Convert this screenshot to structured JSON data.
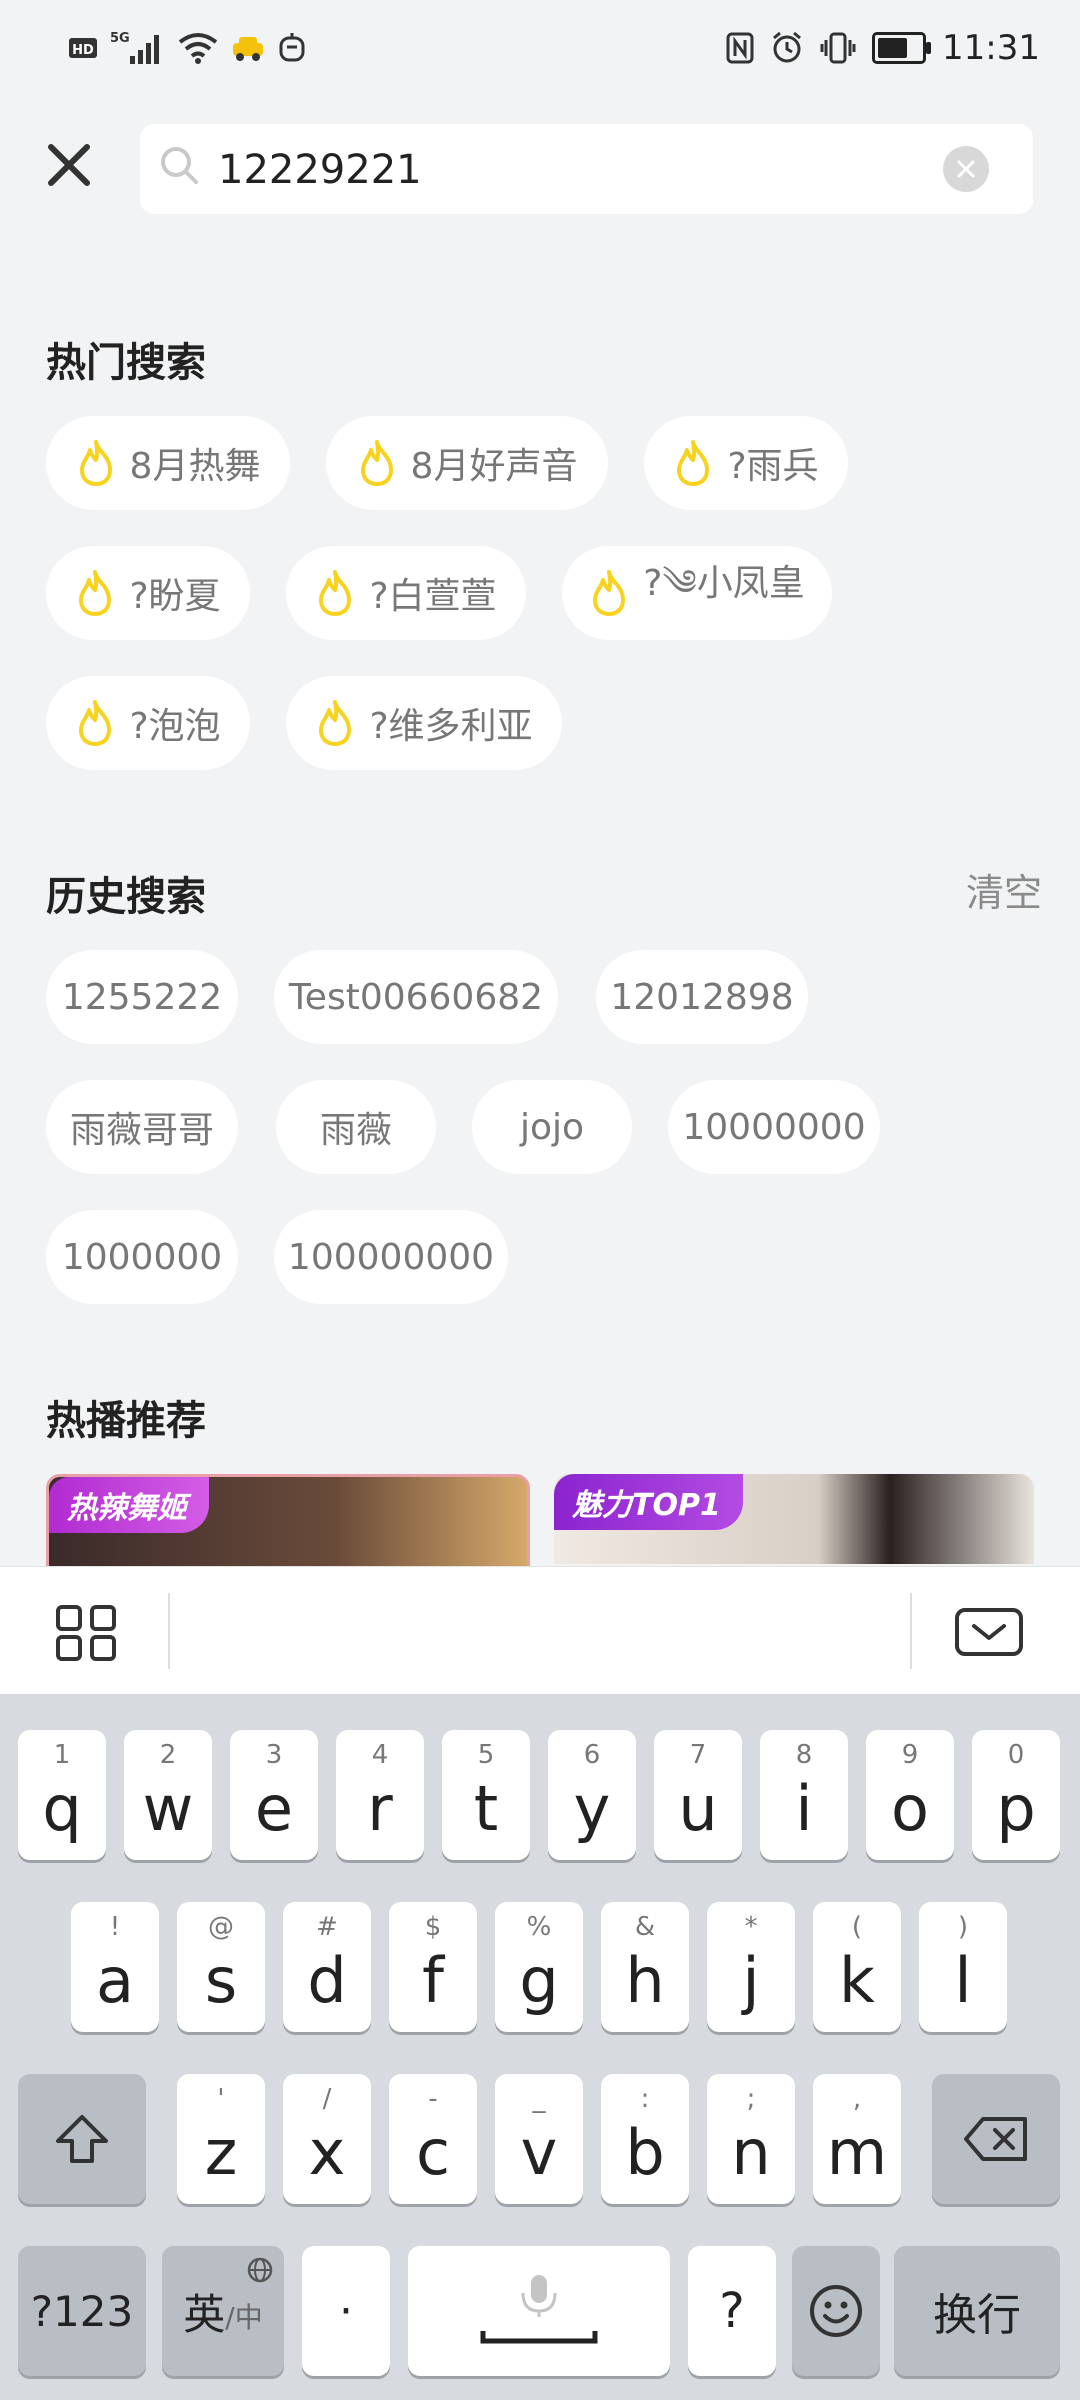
{
  "status_bar": {
    "left_icons": [
      "hd-icon",
      "5g-signal-icon",
      "wifi-icon",
      "taxi-icon",
      "assistant-icon"
    ],
    "right_icons": [
      "nfc-icon",
      "alarm-icon",
      "vibrate-icon",
      "battery-icon"
    ],
    "time": "11:31"
  },
  "search": {
    "value": "12229221"
  },
  "hot_search": {
    "title": "热门搜索",
    "items": [
      "8月热舞",
      "8月好声音",
      "?雨兵",
      "?盼夏",
      "?白萱萱",
      "?༄小凤皇",
      "?泡泡",
      "?维多利亚"
    ]
  },
  "history": {
    "title": "历史搜索",
    "clear_label": "清空",
    "items": [
      "1255222",
      "Test00660682",
      "12012898",
      "雨薇哥哥",
      "雨薇",
      "jojo",
      "10000000",
      "1000000",
      "100000000"
    ]
  },
  "recommend": {
    "title": "热播推荐",
    "badges": [
      "热辣舞姬",
      "魅力TOP1"
    ]
  },
  "keyboard": {
    "row1": [
      [
        "1",
        "q"
      ],
      [
        "2",
        "w"
      ],
      [
        "3",
        "e"
      ],
      [
        "4",
        "r"
      ],
      [
        "5",
        "t"
      ],
      [
        "6",
        "y"
      ],
      [
        "7",
        "u"
      ],
      [
        "8",
        "i"
      ],
      [
        "9",
        "o"
      ],
      [
        "0",
        "p"
      ]
    ],
    "row2": [
      [
        "!",
        "a"
      ],
      [
        "@",
        "s"
      ],
      [
        "#",
        "d"
      ],
      [
        "$",
        "f"
      ],
      [
        "%",
        "g"
      ],
      [
        "&",
        "h"
      ],
      [
        "*",
        "j"
      ],
      [
        "(",
        "k"
      ],
      [
        ")",
        "l"
      ]
    ],
    "row3": [
      [
        "'",
        "z"
      ],
      [
        "/",
        "x"
      ],
      [
        "-",
        "c"
      ],
      [
        "_",
        "v"
      ],
      [
        ":",
        "b"
      ],
      [
        ";",
        "n"
      ],
      [
        ",",
        "m"
      ]
    ],
    "symbols_label": "?123",
    "lang_label": "英",
    "lang_sub": "/中",
    "dot_label": "·",
    "question_label": "?",
    "enter_label": "换行"
  },
  "colors": {
    "flame": "#f7d21e",
    "background": "#f1f3f4",
    "chip_text": "#777777",
    "badge1": "#c43ddb",
    "badge2": "#9b2fd6"
  }
}
